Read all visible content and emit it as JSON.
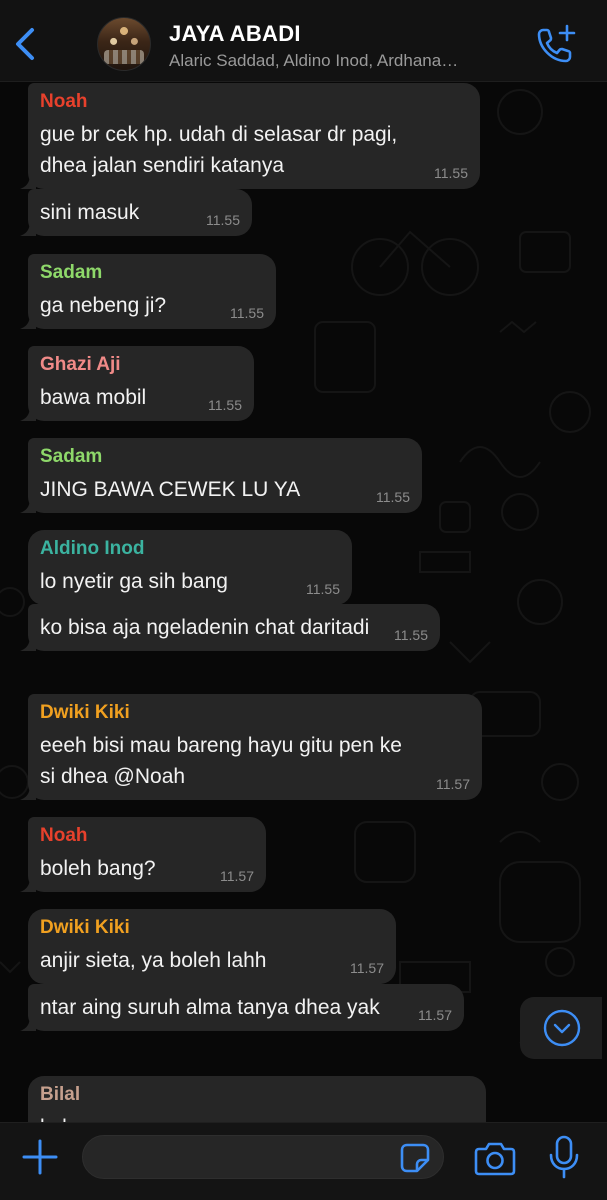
{
  "header": {
    "title": "JAYA ABADI",
    "subtitle": "Alaric Saddad, Aldino Inod, Ardhana…"
  },
  "messages": [
    {
      "sender": "Noah",
      "sender_color": "#e8412c",
      "text": "gue br cek hp. udah di selasar dr pagi,\ndhea jalan sendiri katanya",
      "time": "11.55"
    },
    {
      "sender": "",
      "text": "sini masuk",
      "time": "11.55"
    },
    {
      "sender": "Sadam",
      "sender_color": "#8ed86a",
      "text": "ga nebeng ji?",
      "time": "11.55"
    },
    {
      "sender": "Ghazi Aji",
      "sender_color": "#f08a88",
      "text": "bawa mobil",
      "time": "11.55"
    },
    {
      "sender": "Sadam",
      "sender_color": "#8ed86a",
      "text": "JING BAWA CEWEK LU YA",
      "time": "11.55"
    },
    {
      "sender": "Aldino Inod",
      "sender_color": "#3bb3a0",
      "text": "lo nyetir ga sih bang",
      "time": "11.55"
    },
    {
      "sender": "",
      "text": "ko bisa aja ngeladenin chat daritadi",
      "time": "11.55"
    },
    {
      "sender": "Dwiki Kiki",
      "sender_color": "#f0a020",
      "text": "eeeh bisi mau bareng hayu gitu pen ke\nsi dhea @Noah",
      "time": "11.57"
    },
    {
      "sender": "Noah",
      "sender_color": "#e8412c",
      "text": "boleh bang?",
      "time": "11.57"
    },
    {
      "sender": "Dwiki Kiki",
      "sender_color": "#f0a020",
      "text": "anjir sieta, ya boleh lahh",
      "time": "11.57"
    },
    {
      "sender": "",
      "text": "ntar aing suruh alma tanya dhea yak",
      "time": "11.57"
    },
    {
      "sender": "Bilal",
      "sender_color": "#c6a08e",
      "text": "kalo ngga sama gue gapapa yen",
      "time": ""
    }
  ],
  "composer": {
    "placeholder": "",
    "value": ""
  },
  "colors": {
    "accent": "#3d8ef5",
    "bubble": "#262626",
    "header_bg": "#121212"
  },
  "icons": {
    "back": "chevron-left-icon",
    "call": "phone-plus-icon",
    "scroll": "chevron-down-circle-icon",
    "plus": "plus-icon",
    "sticker": "sticker-icon",
    "camera": "camera-icon",
    "mic": "microphone-icon"
  }
}
